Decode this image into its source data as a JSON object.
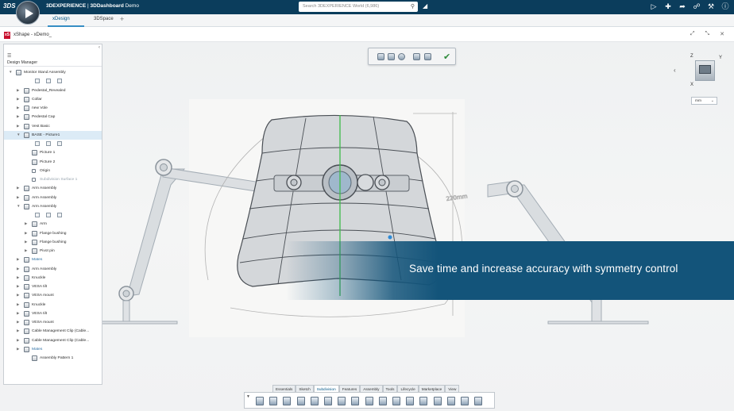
{
  "topbar": {
    "logo_text": "3DS",
    "brand_prefix": "3DEXPERIENCE",
    "brand_separator": " | ",
    "brand_app": "3DDashboard",
    "brand_suffix": " Demo",
    "search_placeholder": "Search 3DEXPERIENCE World (6,986)",
    "icons": [
      "tag-icon",
      "play-share-icon",
      "add-icon",
      "share-icon",
      "network-icon",
      "tools-icon",
      "help-icon"
    ],
    "colors": {
      "bar": "#0b3d5c",
      "accent": "#368ec4"
    }
  },
  "tabs": [
    {
      "label": "xDesign",
      "active": true
    },
    {
      "label": "3DSpace",
      "active": false
    }
  ],
  "tab_plus": "+",
  "app": {
    "logo_text": "xS",
    "title": "xShape - xDemo_",
    "actions": [
      "⤢",
      "⤡",
      "✕"
    ]
  },
  "design_manager": {
    "collapse": "‹",
    "title": "Design Manager",
    "rows": [
      {
        "label": "Monitor Stand Assembly",
        "arrow": "▼",
        "kind": "assembly"
      },
      {
        "label": "",
        "kind": "views"
      },
      {
        "label": "Pedestal_Revealed",
        "arrow": "▶",
        "kind": "part"
      },
      {
        "label": "Collar",
        "arrow": "▶",
        "kind": "part"
      },
      {
        "label": "new Vole",
        "arrow": "▶",
        "kind": "part"
      },
      {
        "label": "Pedestal Cap",
        "arrow": "▶",
        "kind": "part"
      },
      {
        "label": "Vest Basic",
        "arrow": "▶",
        "kind": "part"
      },
      {
        "label": "BASE - Picture1",
        "arrow": "▼",
        "kind": "part",
        "selected": true
      },
      {
        "label": "",
        "kind": "views"
      },
      {
        "label": "Picture 1",
        "kind": "picture"
      },
      {
        "label": "Picture 2",
        "kind": "picture"
      },
      {
        "label": "Origin",
        "kind": "origin"
      },
      {
        "label": "Subdivision Surface 1",
        "kind": "surface",
        "faded": true
      },
      {
        "label": "Arm Assembly",
        "arrow": "▶",
        "kind": "part"
      },
      {
        "label": "Arm Assembly",
        "arrow": "▶",
        "kind": "part"
      },
      {
        "label": "Arm Assembly",
        "arrow": "▼",
        "kind": "part"
      },
      {
        "label": "",
        "kind": "views"
      },
      {
        "label": "Arm",
        "arrow": "▶",
        "kind": "subpart"
      },
      {
        "label": "Flange bushing",
        "arrow": "▶",
        "kind": "subpart"
      },
      {
        "label": "Flange bushing",
        "arrow": "▶",
        "kind": "subpart"
      },
      {
        "label": "Pivot pin",
        "arrow": "▶",
        "kind": "subpart"
      },
      {
        "label": "Mates",
        "arrow": "▶",
        "kind": "link"
      },
      {
        "label": "Arm Assembly",
        "arrow": "▶",
        "kind": "part"
      },
      {
        "label": "Knuckle",
        "arrow": "▶",
        "kind": "part"
      },
      {
        "label": "VESA tilt",
        "arrow": "▶",
        "kind": "part"
      },
      {
        "label": "VESA mount",
        "arrow": "▶",
        "kind": "part"
      },
      {
        "label": "Knuckle",
        "arrow": "▶",
        "kind": "part"
      },
      {
        "label": "VESA tilt",
        "arrow": "▶",
        "kind": "part"
      },
      {
        "label": "VESA mount",
        "arrow": "▶",
        "kind": "part"
      },
      {
        "label": "Cable Management Clip (Cable...",
        "arrow": "▶",
        "kind": "part"
      },
      {
        "label": "Cable Management Clip (Cable...",
        "arrow": "▶",
        "kind": "part"
      },
      {
        "label": "Mates",
        "arrow": "▶",
        "kind": "link"
      },
      {
        "label": "Assembly Pattern 1",
        "kind": "pattern"
      }
    ]
  },
  "viewer": {
    "compass_labels": {
      "z": "Z",
      "y": "Y",
      "x": "X"
    },
    "nav_left": "‹",
    "unit_value": "mm",
    "unit_chevron": "⌄",
    "sketch_dimension": "220mm"
  },
  "banner": {
    "text": "Save time and increase accuracy with symmetry control",
    "color": "#13547a"
  },
  "action_tabs": [
    {
      "label": "Essentials",
      "active": false
    },
    {
      "label": "Sketch",
      "active": false
    },
    {
      "label": "Subdivision",
      "active": true
    },
    {
      "label": "Features",
      "active": false
    },
    {
      "label": "Assembly",
      "active": false
    },
    {
      "label": "Tools",
      "active": false
    },
    {
      "label": "Lifecycle",
      "active": false
    },
    {
      "label": "Marketplace",
      "active": false
    },
    {
      "label": "View",
      "active": false
    }
  ],
  "action_bar_icons": [
    "pin-icon",
    "box-icon",
    "sphere-icon",
    "grid-icon",
    "select-icon",
    "extrude-icon",
    "face-icon",
    "edge-icon",
    "split-icon",
    "crease-icon",
    "bridge-icon",
    "fill-icon",
    "mirror-icon",
    "symmetry-icon",
    "weld-icon",
    "delete-icon",
    "thicken-icon",
    "convert-icon"
  ]
}
